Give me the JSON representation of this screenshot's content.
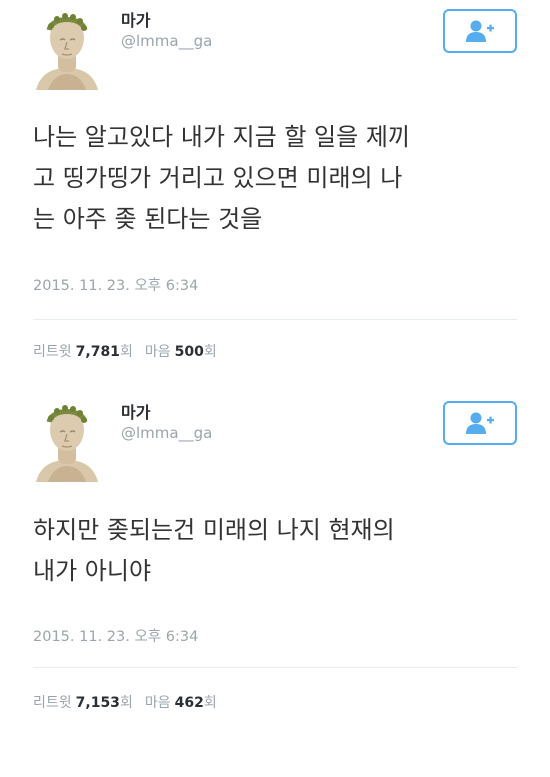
{
  "tweets": [
    {
      "author_name": "마가",
      "author_handle": "@lmma__ga",
      "text": "나는 알고있다 내가 지금 할 일을 제끼\n고 띵가띵가 거리고 있으면 미래의 나\n는 아주 좆 된다는 것을",
      "timestamp": "2015. 11. 23. 오후 6:34",
      "retweet_label": "리트윗",
      "retweet_count": "7,781",
      "retweet_unit": "회",
      "like_label": "마음",
      "like_count": "500",
      "like_unit": "회"
    },
    {
      "author_name": "마가",
      "author_handle": "@lmma__ga",
      "text": "하지만 좆되는건 미래의 나지 현재의\n내가 아니야",
      "timestamp": "2015. 11. 23. 오후 6:34",
      "retweet_label": "리트윗",
      "retweet_count": "7,153",
      "retweet_unit": "회",
      "like_label": "마음",
      "like_count": "462",
      "like_unit": "회"
    }
  ],
  "icons": {
    "follow": "follow-user-icon",
    "avatar": "caesar-bust-avatar"
  },
  "colors": {
    "accent": "#55acee",
    "text": "#333333",
    "muted": "#9aa5ad",
    "divider": "#e6ecf0"
  }
}
